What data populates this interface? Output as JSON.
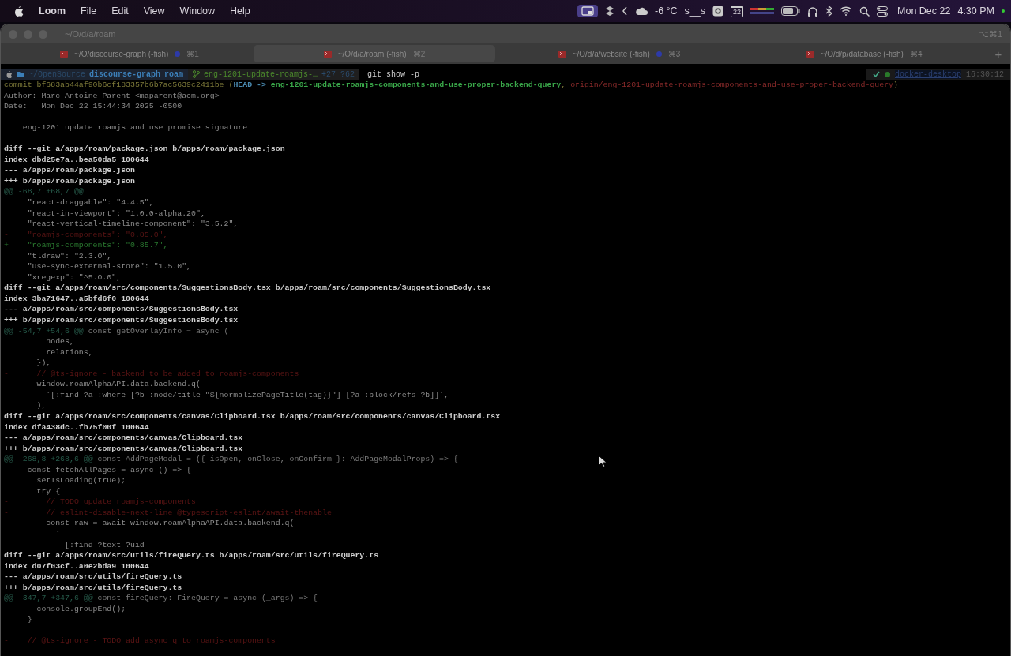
{
  "menu_bar": {
    "app": "Loom",
    "items": [
      "File",
      "Edit",
      "View",
      "Window",
      "Help"
    ],
    "status": {
      "temperature": "-6 °C",
      "user": "s__s",
      "calendar_day": "22",
      "date": "Mon Dec 22",
      "time": "4:30 PM"
    }
  },
  "window": {
    "title": "~/O/d/a/roam",
    "shortcut": "⌥⌘1"
  },
  "tabs": [
    {
      "title": "~/O/discourse-graph (-fish)",
      "shortcut": "⌘1",
      "selected": false,
      "activity": true
    },
    {
      "title": "~/O/d/a/roam (-fish)",
      "shortcut": "⌘2",
      "selected": true,
      "activity": false
    },
    {
      "title": "~/O/d/a/website (-fish)",
      "shortcut": "⌘3",
      "selected": false,
      "activity": true
    },
    {
      "title": "~/O/d/p/database (-fish)",
      "shortcut": "⌘4",
      "selected": false,
      "activity": false
    }
  ],
  "new_tab": "+",
  "prompt": {
    "root": "~/OpenSource",
    "repo": "discourse-graph",
    "dir": "roam",
    "branch": "eng-1201-update-roamjs-…",
    "git_status": "+27 ?62",
    "command": "git show -p",
    "context": "docker-desktop",
    "clock": "16:30:12"
  },
  "commit": {
    "hash": "commit bf683ab44af90b6cf183357b6b7ac5639c2411be",
    "open_paren": "(",
    "close_paren": ")",
    "separator": ",",
    "head": "HEAD ->",
    "branch": "eng-1201-update-roamjs-components-and-use-proper-backend-query",
    "remote": "origin/eng-1201-update-roamjs-components-and-use-proper-backend-query"
  },
  "lines": [
    {
      "kind": "meta",
      "text": "Author: Marc-Antoine Parent <maparent@acm.org>"
    },
    {
      "kind": "meta",
      "text": "Date:   Mon Dec 22 15:44:34 2025 -0500"
    },
    {
      "kind": "blank"
    },
    {
      "kind": "meta",
      "text": "    eng-1201 update roamjs and use promise signature"
    },
    {
      "kind": "blank"
    },
    {
      "kind": "header",
      "text": "diff --git a/apps/roam/package.json b/apps/roam/package.json"
    },
    {
      "kind": "header",
      "text": "index dbd25e7a..bea50da5 100644"
    },
    {
      "kind": "header",
      "text": "--- a/apps/roam/package.json"
    },
    {
      "kind": "header",
      "text": "+++ b/apps/roam/package.json"
    },
    {
      "kind": "hunk",
      "text": "@@ -68,7 +68,7 @@"
    },
    {
      "kind": "context",
      "text": "     \"react-draggable\": \"4.4.5\","
    },
    {
      "kind": "context",
      "text": "     \"react-in-viewport\": \"1.0.0-alpha.20\","
    },
    {
      "kind": "context",
      "text": "     \"react-vertical-timeline-component\": \"3.5.2\","
    },
    {
      "kind": "removed",
      "text": "-    \"roamjs-components\": \"0.85.0\","
    },
    {
      "kind": "added",
      "text": "+    \"roamjs-components\": \"0.85.7\","
    },
    {
      "kind": "context",
      "text": "     \"tldraw\": \"2.3.0\","
    },
    {
      "kind": "context",
      "text": "     \"use-sync-external-store\": \"1.5.0\","
    },
    {
      "kind": "context",
      "text": "     \"xregexp\": \"^5.0.0\","
    },
    {
      "kind": "header",
      "text": "diff --git a/apps/roam/src/components/SuggestionsBody.tsx b/apps/roam/src/components/SuggestionsBody.tsx"
    },
    {
      "kind": "header",
      "text": "index 3ba71647..a5bfd6f0 100644"
    },
    {
      "kind": "header",
      "text": "--- a/apps/roam/src/components/SuggestionsBody.tsx"
    },
    {
      "kind": "header",
      "text": "+++ b/apps/roam/src/components/SuggestionsBody.tsx"
    },
    {
      "kind": "hunk",
      "text": "@@ -54,7 +54,6 @@",
      "heading": " const getOverlayInfo = async ("
    },
    {
      "kind": "context",
      "text": "         nodes,"
    },
    {
      "kind": "context",
      "text": "         relations,"
    },
    {
      "kind": "context",
      "text": "       }),"
    },
    {
      "kind": "removed",
      "text": "-      // @ts-ignore - backend to be added to roamjs-components"
    },
    {
      "kind": "context",
      "text": "       window.roamAlphaAPI.data.backend.q("
    },
    {
      "kind": "context",
      "text": "         `[:find ?a :where [?b :node/title \"${normalizePageTitle(tag)}\"] [?a :block/refs ?b]]`,"
    },
    {
      "kind": "context",
      "text": "       ),"
    },
    {
      "kind": "header",
      "text": "diff --git a/apps/roam/src/components/canvas/Clipboard.tsx b/apps/roam/src/components/canvas/Clipboard.tsx"
    },
    {
      "kind": "header",
      "text": "index dfa438dc..fb75f00f 100644"
    },
    {
      "kind": "header",
      "text": "--- a/apps/roam/src/components/canvas/Clipboard.tsx"
    },
    {
      "kind": "header",
      "text": "+++ b/apps/roam/src/components/canvas/Clipboard.tsx"
    },
    {
      "kind": "hunk",
      "text": "@@ -268,8 +268,6 @@",
      "heading": " const AddPageModal = ({ isOpen, onClose, onConfirm }: AddPageModalProps) => {"
    },
    {
      "kind": "context",
      "text": "     const fetchAllPages = async () => {"
    },
    {
      "kind": "context",
      "text": "       setIsLoading(true);"
    },
    {
      "kind": "context",
      "text": "       try {"
    },
    {
      "kind": "removed",
      "text": "-        // TODO update roamjs-components"
    },
    {
      "kind": "removed",
      "text": "-        // eslint-disable-next-line @typescript-eslint/await-thenable"
    },
    {
      "kind": "context",
      "text": "         const raw = await window.roamAlphaAPI.data.backend.q("
    },
    {
      "kind": "context",
      "text": "           `"
    },
    {
      "kind": "context",
      "text": "             [:find ?text ?uid"
    },
    {
      "kind": "header",
      "text": "diff --git a/apps/roam/src/utils/fireQuery.ts b/apps/roam/src/utils/fireQuery.ts"
    },
    {
      "kind": "header",
      "text": "index d07f03cf..a0e2bda9 100644"
    },
    {
      "kind": "header",
      "text": "--- a/apps/roam/src/utils/fireQuery.ts"
    },
    {
      "kind": "header",
      "text": "+++ b/apps/roam/src/utils/fireQuery.ts"
    },
    {
      "kind": "hunk",
      "text": "@@ -347,7 +347,6 @@",
      "heading": " const fireQuery: FireQuery = async (_args) => {"
    },
    {
      "kind": "context",
      "text": "       console.groupEnd();"
    },
    {
      "kind": "context",
      "text": "     }"
    },
    {
      "kind": "blank"
    },
    {
      "kind": "removed",
      "text": "-    // @ts-ignore - TODO add async q to roamjs-components"
    }
  ]
}
